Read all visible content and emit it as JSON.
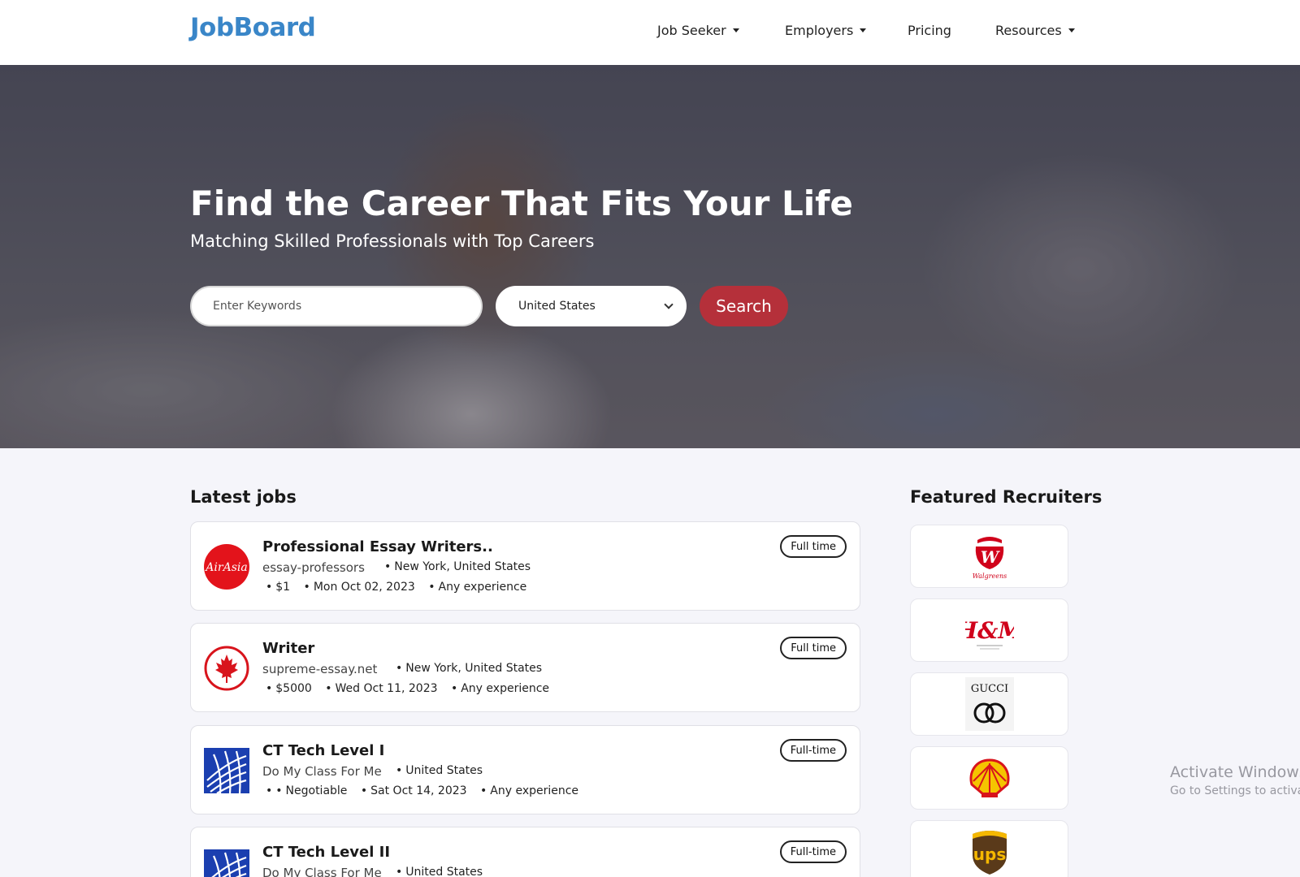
{
  "header": {
    "logo": "JobBoard",
    "nav": [
      {
        "label": "Job Seeker",
        "has_dropdown": true
      },
      {
        "label": "Employers",
        "has_dropdown": true
      },
      {
        "label": "Pricing",
        "has_dropdown": false
      },
      {
        "label": "Resources",
        "has_dropdown": true
      }
    ]
  },
  "hero": {
    "title": "Find the Career That Fits Your Life",
    "subtitle": "Matching Skilled Professionals with Top Careers",
    "keywords_placeholder": "Enter Keywords",
    "country_selected": "United States",
    "search_label": "Search"
  },
  "latest_jobs": {
    "title": "Latest jobs",
    "jobs": [
      {
        "title": "Professional Essay Writers..",
        "company": "essay-professors",
        "location": "New York, United States",
        "salary": "$1",
        "date": "Mon Oct 02, 2023",
        "experience": "Any experience",
        "type": "Full time",
        "logo": "airasia-logo"
      },
      {
        "title": "Writer",
        "company": "supreme-essay.net",
        "location": "New York, United States",
        "salary": "$5000",
        "date": "Wed Oct 11, 2023",
        "experience": "Any experience",
        "type": "Full time",
        "logo": "maple-leaf-logo"
      },
      {
        "title": "CT Tech Level I",
        "company": "Do My Class For Me",
        "location": "United States",
        "salary": "Negotiable",
        "date": "Sat Oct 14, 2023",
        "experience": "Any experience",
        "type": "Full-time",
        "logo": "globe-logo"
      },
      {
        "title": "CT Tech Level II",
        "company": "Do My Class For Me",
        "location": "United States",
        "salary": "",
        "date": "",
        "experience": "",
        "type": "Full-time",
        "logo": "globe-logo"
      }
    ]
  },
  "featured_recruiters": {
    "title": "Featured Recruiters",
    "recruiters": [
      {
        "name": "Walgreens",
        "logo_text": "W",
        "logo_caption": "Walgreens",
        "color": "#d0021b"
      },
      {
        "name": "H&M",
        "logo_text": "H&M",
        "color": "#d0021b"
      },
      {
        "name": "Gucci",
        "logo_text": "GUCCI",
        "color": "#111111"
      },
      {
        "name": "Shell",
        "logo_text": "",
        "color": "#f5c400"
      },
      {
        "name": "UPS",
        "logo_text": "ups",
        "color": "#5a3a1a"
      }
    ]
  },
  "watermark": {
    "line1": "Activate Windows",
    "line2": "Go to Settings to activat"
  },
  "colors": {
    "brand": "#3a86c8",
    "search_button": "#b5303a",
    "page_background": "#f5f5fa"
  }
}
